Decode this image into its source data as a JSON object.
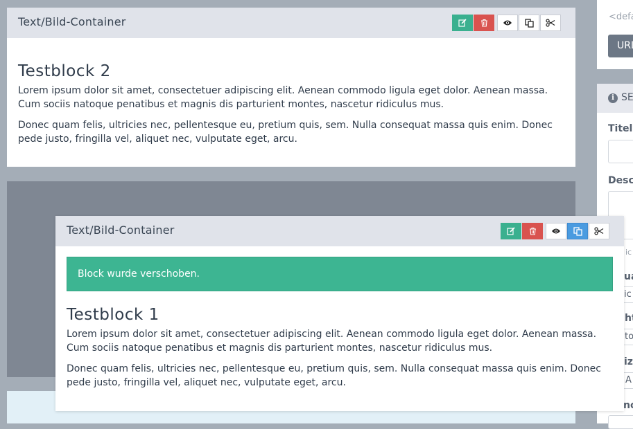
{
  "block_top": {
    "header_title": "Text/Bild-Container",
    "heading": "Testblock 2",
    "paragraphs": [
      "Lorem ipsum dolor sit amet, consectetuer adipiscing elit. Aenean commodo ligula eget dolor. Aenean massa. Cum sociis natoque penatibus et magnis dis parturient montes, nascetur ridiculus mus.",
      "Donec quam felis, ultricies nec, pellentesque eu, pretium quis, sem. Nulla consequat massa quis enim. Donec pede justo, fringilla vel, aliquet nec, vulputate eget, arcu."
    ]
  },
  "block_dragged": {
    "header_title": "Text/Bild-Container",
    "alert": "Block wurde verschoben.",
    "heading": "Testblock 1",
    "paragraphs": [
      "Lorem ipsum dolor sit amet, consectetuer adipiscing elit. Aenean commodo ligula eget dolor. Aenean massa. Cum sociis natoque penatibus et magnis dis parturient montes, nascetur ridiculus mus.",
      "Donec quam felis, ultricies nec, pellentesque eu, pretium quis, sem. Nulla consequat massa quis enim. Donec pede justo, fringilla vel, aliquet nec, vulputate eget, arcu."
    ]
  },
  "toolbar_icons": [
    "edit-icon",
    "trash-icon",
    "eye-icon",
    "copy-icon",
    "scissors-icon"
  ],
  "sidebar": {
    "default_hint": "<defa",
    "url_button": "URL",
    "section_title": "SE",
    "labels": [
      "Titel",
      "Desc",
      "ua",
      "ht",
      "iz",
      "no"
    ],
    "hint_small": "ic",
    "values": [
      "ic",
      "to",
      "A"
    ]
  },
  "colors": {
    "edit_green": "#3ab08f",
    "delete_red": "#d9534f",
    "copy_active_blue": "#4a9be0",
    "alert_green": "#3db592",
    "dropzone_gray": "#7f8793"
  }
}
